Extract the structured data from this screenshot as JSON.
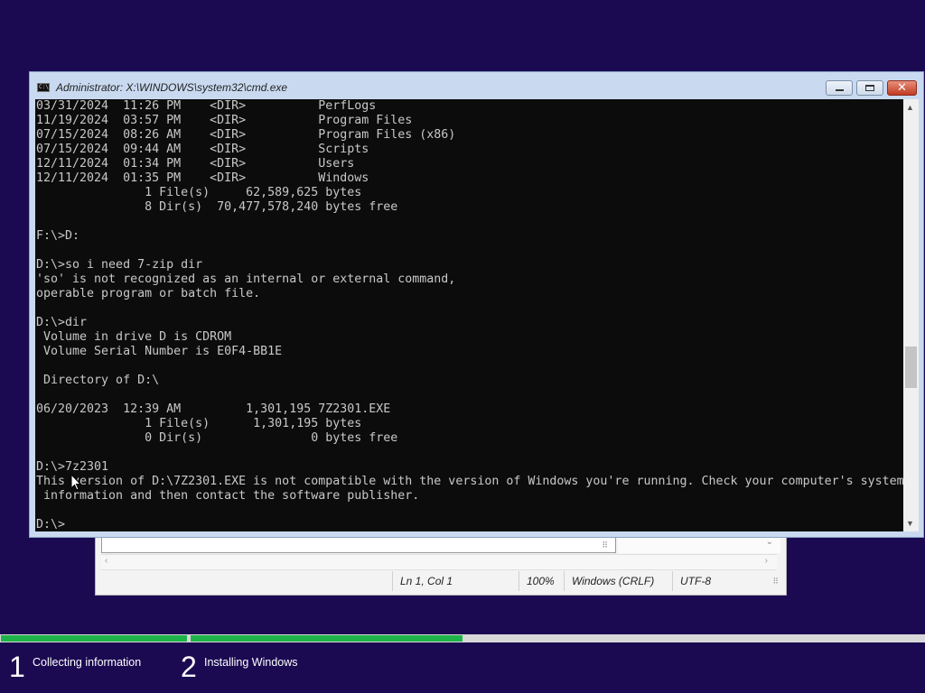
{
  "colors": {
    "background": "#1b0a52",
    "progress_complete": "#1fb44a",
    "progress_track": "#d8d8d8",
    "console_bg": "#0c0c0c",
    "console_fg": "#c8c8c8"
  },
  "notepad": {
    "status": {
      "position": "Ln 1, Col 1",
      "zoom": "100%",
      "line_ending": "Windows (CRLF)",
      "encoding": "UTF-8"
    }
  },
  "cmd": {
    "title": "Administrator: X:\\WINDOWS\\system32\\cmd.exe",
    "icon": "console-icon",
    "buttons": {
      "minimize": "minimize-icon",
      "maximize": "maximize-icon",
      "close": "close-icon"
    },
    "close_glyph": "✕",
    "lines": [
      "03/31/2024  11:26 PM    <DIR>          PerfLogs",
      "11/19/2024  03:57 PM    <DIR>          Program Files",
      "07/15/2024  08:26 AM    <DIR>          Program Files (x86)",
      "07/15/2024  09:44 AM    <DIR>          Scripts",
      "12/11/2024  01:34 PM    <DIR>          Users",
      "12/11/2024  01:35 PM    <DIR>          Windows",
      "               1 File(s)     62,589,625 bytes",
      "               8 Dir(s)  70,477,578,240 bytes free",
      "",
      "F:\\>D:",
      "",
      "D:\\>so i need 7-zip dir",
      "'so' is not recognized as an internal or external command,",
      "operable program or batch file.",
      "",
      "D:\\>dir",
      " Volume in drive D is CDROM",
      " Volume Serial Number is E0F4-BB1E",
      "",
      " Directory of D:\\",
      "",
      "06/20/2023  12:39 AM         1,301,195 7Z2301.EXE",
      "               1 File(s)      1,301,195 bytes",
      "               0 Dir(s)               0 bytes free",
      "",
      "D:\\>7z2301",
      "This version of D:\\7Z2301.EXE is not compatible with the version of Windows you're running. Check your computer's system",
      " information and then contact the software publisher.",
      "",
      "D:\\>"
    ]
  },
  "setup": {
    "progress": [
      1.0,
      0.37
    ],
    "steps": [
      {
        "number": "1",
        "label": "Collecting information"
      },
      {
        "number": "2",
        "label": "Installing Windows"
      }
    ]
  }
}
